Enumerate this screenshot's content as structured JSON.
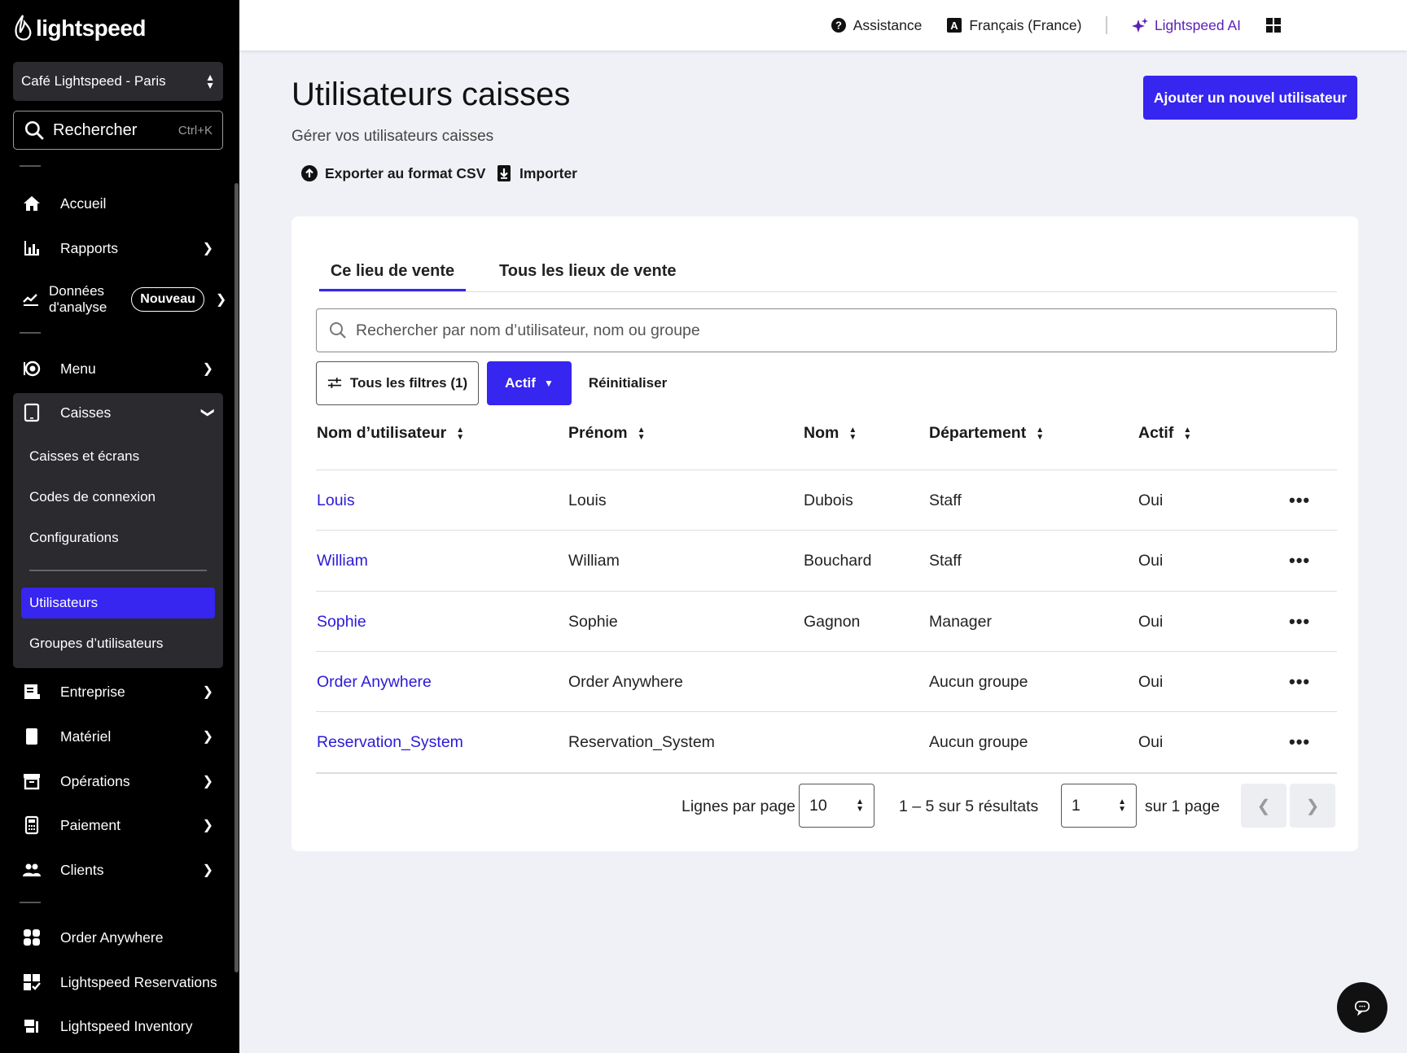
{
  "brand": {
    "name": "lightspeed"
  },
  "sidebar": {
    "store": "Café Lightspeed - Paris",
    "search": {
      "label": "Rechercher",
      "shortcut": "Ctrl+K"
    },
    "items": {
      "accueil": "Accueil",
      "rapports": "Rapports",
      "donnees_line1": "Données",
      "donnees_line2": "d'analyse",
      "nouveau_badge": "Nouveau",
      "menu": "Menu",
      "caisses": "Caisses",
      "entreprise": "Entreprise",
      "materiel": "Matériel",
      "operations": "Opérations",
      "paiement": "Paiement",
      "clients": "Clients",
      "order_anywhere": "Order Anywhere",
      "reservations": "Lightspeed Reservations",
      "inventory": "Lightspeed Inventory"
    },
    "caisses_sub": {
      "caisses_ecrans": "Caisses et écrans",
      "codes": "Codes de connexion",
      "configurations": "Configurations",
      "utilisateurs": "Utilisateurs",
      "groupes": "Groupes d’utilisateurs"
    }
  },
  "topbar": {
    "assistance": "Assistance",
    "language": "Français (France)",
    "ai": "Lightspeed AI"
  },
  "page": {
    "title": "Utilisateurs caisses",
    "subtitle": "Gérer vos utilisateurs caisses",
    "add_button": "Ajouter un nouvel utilisateur",
    "export": "Exporter au format CSV",
    "import": "Importer"
  },
  "tabs": {
    "this": "Ce lieu de vente",
    "all": "Tous les lieux de vente"
  },
  "search": {
    "placeholder": "Rechercher par nom d’utilisateur, nom ou groupe"
  },
  "filters": {
    "all": "Tous les filtres (1)",
    "active": "Actif",
    "reset": "Réinitialiser"
  },
  "table": {
    "headers": {
      "username": "Nom d’utilisateur",
      "firstname": "Prénom",
      "lastname": "Nom",
      "department": "Département",
      "active": "Actif"
    },
    "rows": [
      {
        "username": "Louis",
        "firstname": "Louis",
        "lastname": "Dubois",
        "department": "Staff",
        "active": "Oui"
      },
      {
        "username": "William",
        "firstname": "William",
        "lastname": "Bouchard",
        "department": "Staff",
        "active": "Oui"
      },
      {
        "username": "Sophie",
        "firstname": "Sophie",
        "lastname": "Gagnon",
        "department": "Manager",
        "active": "Oui"
      },
      {
        "username": "Order Anywhere",
        "firstname": "Order Anywhere",
        "lastname": "",
        "department": "Aucun groupe",
        "active": "Oui"
      },
      {
        "username": "Reservation_System",
        "firstname": "Reservation_System",
        "lastname": "",
        "department": "Aucun groupe",
        "active": "Oui"
      }
    ],
    "more": "•••"
  },
  "pagination": {
    "rows_label": "Lignes par page",
    "rows_value": "10",
    "results": "1 – 5 sur 5 résultats",
    "page_value": "1",
    "page_of": "sur 1 page"
  },
  "colors": {
    "accent": "#3725f0",
    "link": "#2a1ad8",
    "sidebar": "#000000"
  }
}
